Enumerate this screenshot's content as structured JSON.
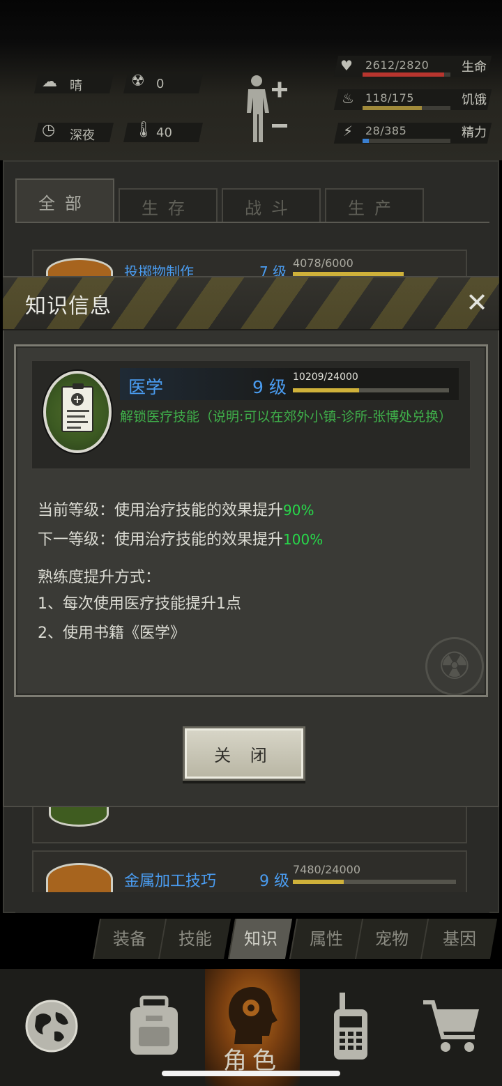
{
  "status": {
    "weather": {
      "icon": "cloud-sun-icon",
      "label": "晴"
    },
    "radiation": {
      "icon": "radiation-icon",
      "value": "0"
    },
    "time": {
      "icon": "clock-icon",
      "label": "深夜"
    },
    "temperature": {
      "icon": "thermometer-icon",
      "value": "40"
    },
    "character_icon": "body-plus-minus-icon",
    "stats": [
      {
        "name": "health",
        "icon": "heart-pulse-icon",
        "value": "2612/2820",
        "label": "生命",
        "fill": 0.926,
        "color": "#b8352e"
      },
      {
        "name": "hunger",
        "icon": "stomach-icon",
        "value": "118/175",
        "label": "饥饿",
        "fill": 0.674,
        "color": "#a08a3a"
      },
      {
        "name": "energy",
        "icon": "energy-icon",
        "value": "28/385",
        "label": "精力",
        "fill": 0.073,
        "color": "#3a7fd0"
      }
    ]
  },
  "knowledge_tabs": [
    "全部",
    "生存",
    "战斗",
    "生产"
  ],
  "knowledge_list": [
    {
      "name": "投掷物制作",
      "level": "7 级",
      "progress": "4078/6000",
      "fill": 0.68
    },
    {
      "name": "金属加工技巧",
      "level": "9 级",
      "progress": "7480/24000",
      "fill": 0.31
    }
  ],
  "modal": {
    "title": "知识信息",
    "close_icon": "close-icon",
    "skill": {
      "icon": "medical-clipboard-icon",
      "name": "医学",
      "level": "9 级",
      "progress": "10209/24000",
      "fill": 0.425,
      "description": "解锁医疗技能（说明:可以在郊外小镇-诊所-张博处兑换）"
    },
    "current_level_prefix": "当前等级：使用治疗技能的效果提升",
    "current_level_value": "90%",
    "next_level_prefix": "下一等级：使用治疗技能的效果提升",
    "next_level_value": "100%",
    "methods_title": "熟练度提升方式：",
    "methods": [
      "1、每次使用医疗技能提升1点",
      "2、使用书籍《医学》"
    ],
    "close_button": "关 闭"
  },
  "sub_tabs": [
    "装备",
    "技能",
    "知识",
    "属性",
    "宠物",
    "基因"
  ],
  "active_sub_tab": "知识",
  "bottom_nav": [
    {
      "name": "world",
      "icon": "globe-icon"
    },
    {
      "name": "inventory",
      "icon": "backpack-icon"
    },
    {
      "name": "role",
      "icon": "head-gear-icon",
      "label": "角色"
    },
    {
      "name": "radio",
      "icon": "walkie-talkie-icon"
    },
    {
      "name": "shop",
      "icon": "shopping-cart-icon"
    }
  ]
}
